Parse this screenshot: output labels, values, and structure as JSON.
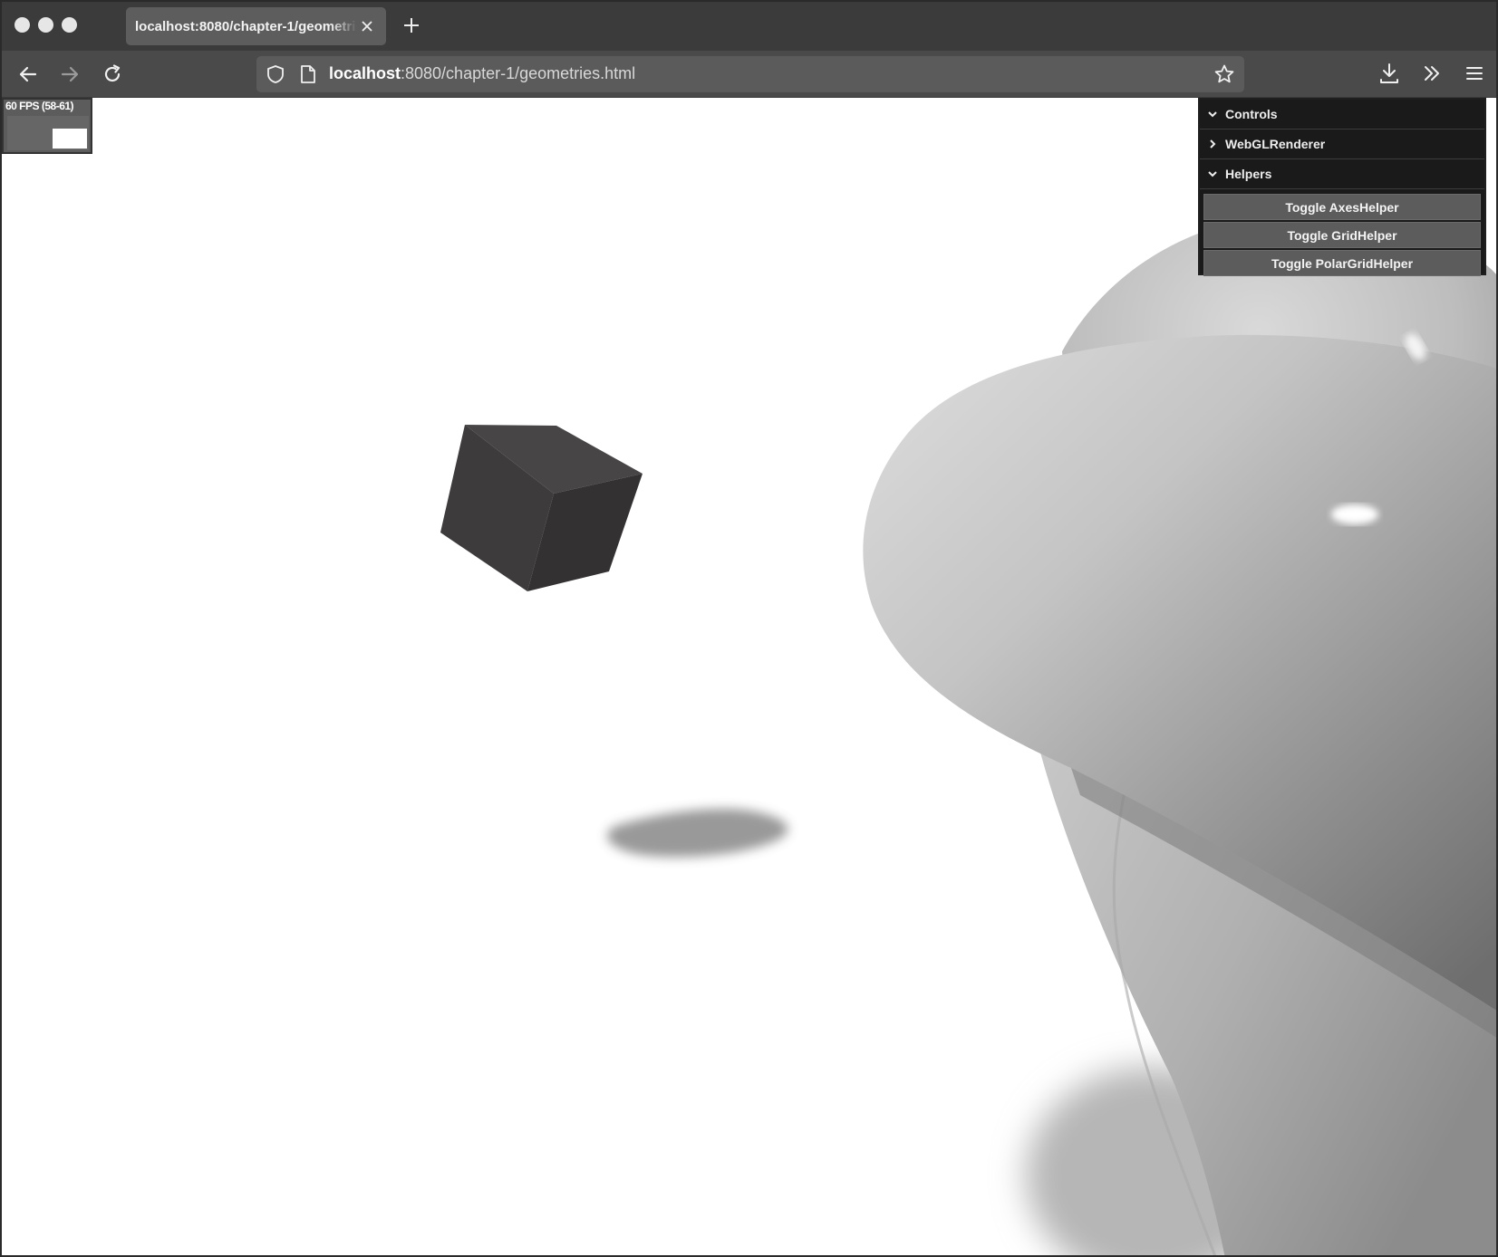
{
  "browser": {
    "tab": {
      "title": "localhost:8080/chapter-1/geometries.html"
    },
    "url": {
      "host": "localhost",
      "path": ":8080/chapter-1/geometries.html"
    }
  },
  "stats": {
    "fps_text": "60 FPS (58-61)"
  },
  "gui": {
    "folders": {
      "controls": "Controls",
      "renderer": "WebGLRenderer",
      "helpers": "Helpers"
    },
    "buttons": {
      "axes": "Toggle AxesHelper",
      "grid": "Toggle GridHelper",
      "polar": "Toggle PolarGridHelper"
    }
  },
  "icons": {
    "tab_close": "close-icon",
    "new_tab": "plus-icon",
    "back": "arrow-left-icon",
    "forward": "arrow-right-icon",
    "reload": "reload-icon",
    "shield": "shield-icon",
    "page": "page-icon",
    "bookmark": "star-icon",
    "downloads": "download-icon",
    "overflow": "double-chevron-icon",
    "menu": "hamburger-icon"
  }
}
